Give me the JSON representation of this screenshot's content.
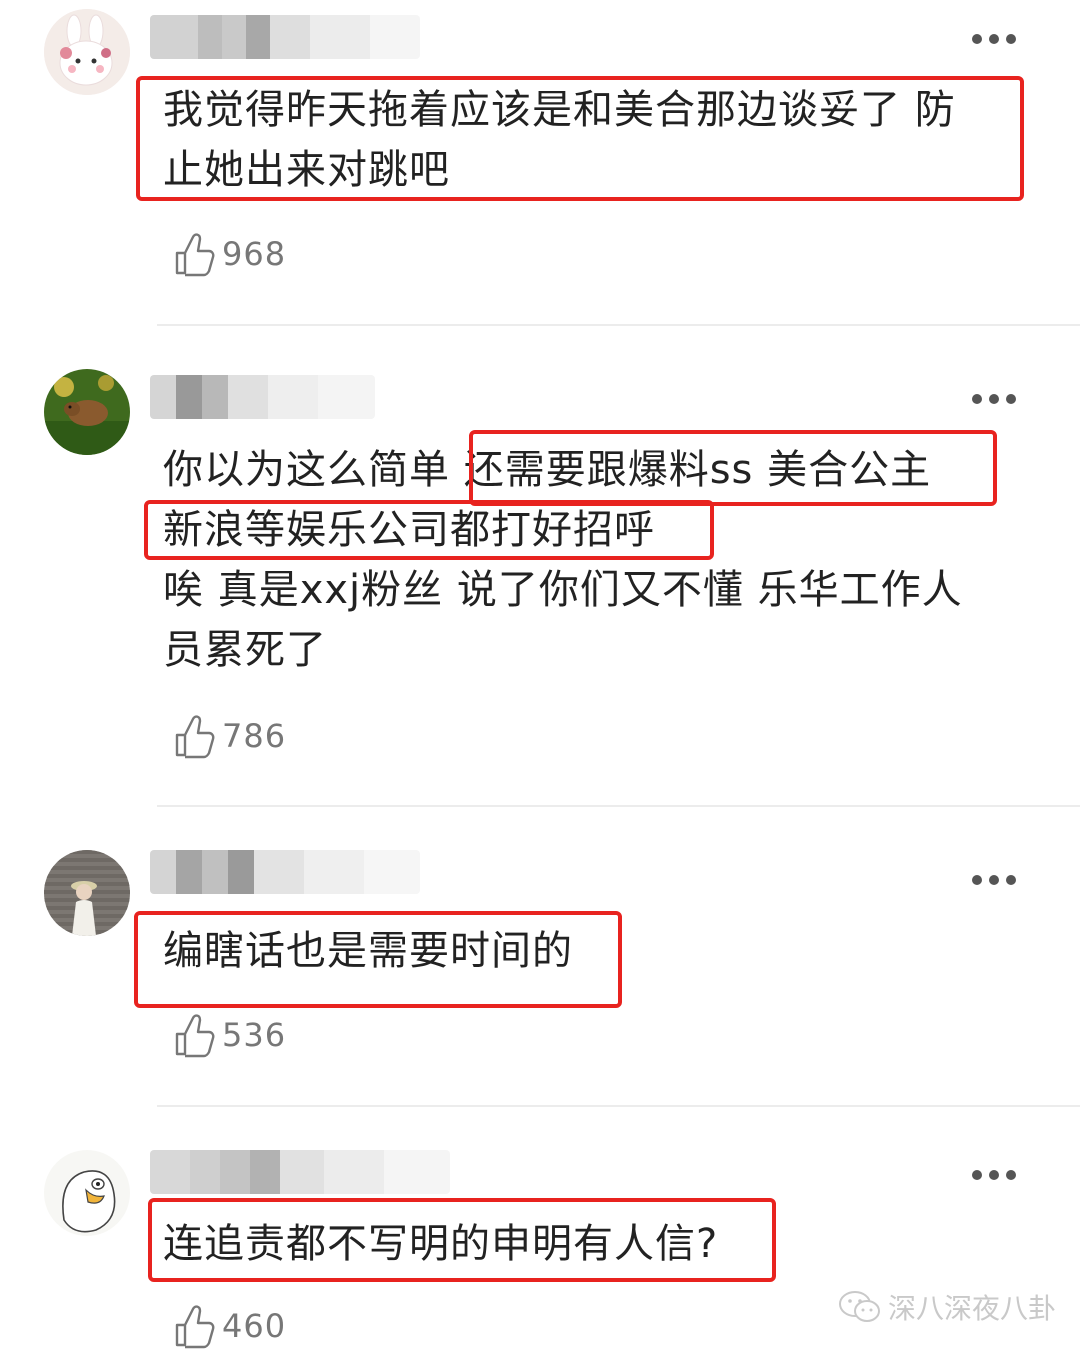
{
  "comments": [
    {
      "text_lines": [
        "我觉得昨天拖着应该是和美合那边谈妥了 防",
        "止她出来对跳吧"
      ],
      "likes": "968",
      "avatar": "bunny-avatar"
    },
    {
      "text_lines": [
        "你以为这么简单 还需要跟爆料ss 美合公主",
        "新浪等娱乐公司都打好招呼",
        "唉 真是xxj粉丝 说了你们又不懂 乐华工作人",
        "员累死了"
      ],
      "likes": "786",
      "avatar": "capybara-avatar"
    },
    {
      "text_lines": [
        "编瞎话也是需要时间的"
      ],
      "likes": "536",
      "avatar": "person-avatar"
    },
    {
      "text_lines": [
        "连追责都不写明的申明有人信?"
      ],
      "likes": "460",
      "avatar": "duck-avatar"
    }
  ],
  "watermark": {
    "text": "深八深夜八卦",
    "icon": "wechat-icon"
  },
  "colors": {
    "highlight": "#e8231f",
    "text": "#222222",
    "muted": "#777777",
    "divider": "#ececec"
  }
}
